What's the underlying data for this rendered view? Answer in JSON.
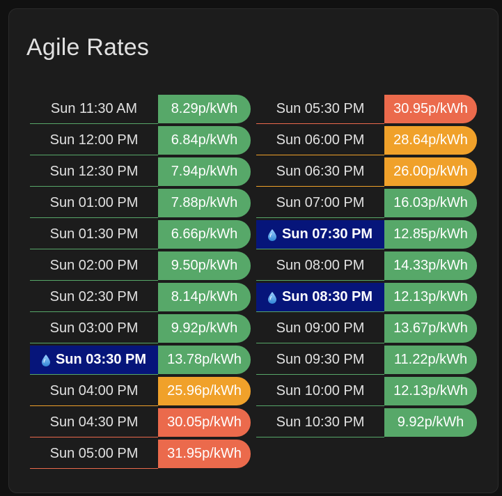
{
  "card": {
    "title": "Agile Rates"
  },
  "colors": {
    "green": "#57a869",
    "orange": "#f0a12a",
    "red": "#eb6a4c",
    "cheapest_bg": "#06157a"
  },
  "icons": {
    "cheapest": "water-drop-icon"
  },
  "columns": [
    [
      {
        "time": "Sun 11:30 AM",
        "price": "8.29p/kWh",
        "level": "green",
        "cheapest": false
      },
      {
        "time": "Sun 12:00 PM",
        "price": "6.84p/kWh",
        "level": "green",
        "cheapest": false
      },
      {
        "time": "Sun 12:30 PM",
        "price": "7.94p/kWh",
        "level": "green",
        "cheapest": false
      },
      {
        "time": "Sun 01:00 PM",
        "price": "7.88p/kWh",
        "level": "green",
        "cheapest": false
      },
      {
        "time": "Sun 01:30 PM",
        "price": "6.66p/kWh",
        "level": "green",
        "cheapest": false
      },
      {
        "time": "Sun 02:00 PM",
        "price": "9.50p/kWh",
        "level": "green",
        "cheapest": false
      },
      {
        "time": "Sun 02:30 PM",
        "price": "8.14p/kWh",
        "level": "green",
        "cheapest": false
      },
      {
        "time": "Sun 03:00 PM",
        "price": "9.92p/kWh",
        "level": "green",
        "cheapest": false
      },
      {
        "time": "Sun 03:30 PM",
        "price": "13.78p/kWh",
        "level": "green",
        "cheapest": true
      },
      {
        "time": "Sun 04:00 PM",
        "price": "25.96p/kWh",
        "level": "orange",
        "cheapest": false
      },
      {
        "time": "Sun 04:30 PM",
        "price": "30.05p/kWh",
        "level": "red",
        "cheapest": false
      },
      {
        "time": "Sun 05:00 PM",
        "price": "31.95p/kWh",
        "level": "red",
        "cheapest": false
      }
    ],
    [
      {
        "time": "Sun 05:30 PM",
        "price": "30.95p/kWh",
        "level": "red",
        "cheapest": false
      },
      {
        "time": "Sun 06:00 PM",
        "price": "28.64p/kWh",
        "level": "orange",
        "cheapest": false
      },
      {
        "time": "Sun 06:30 PM",
        "price": "26.00p/kWh",
        "level": "orange",
        "cheapest": false
      },
      {
        "time": "Sun 07:00 PM",
        "price": "16.03p/kWh",
        "level": "green",
        "cheapest": false
      },
      {
        "time": "Sun 07:30 PM",
        "price": "12.85p/kWh",
        "level": "green",
        "cheapest": true
      },
      {
        "time": "Sun 08:00 PM",
        "price": "14.33p/kWh",
        "level": "green",
        "cheapest": false
      },
      {
        "time": "Sun 08:30 PM",
        "price": "12.13p/kWh",
        "level": "green",
        "cheapest": true
      },
      {
        "time": "Sun 09:00 PM",
        "price": "13.67p/kWh",
        "level": "green",
        "cheapest": false
      },
      {
        "time": "Sun 09:30 PM",
        "price": "11.22p/kWh",
        "level": "green",
        "cheapest": false
      },
      {
        "time": "Sun 10:00 PM",
        "price": "12.13p/kWh",
        "level": "green",
        "cheapest": false
      },
      {
        "time": "Sun 10:30 PM",
        "price": "9.92p/kWh",
        "level": "green",
        "cheapest": false
      }
    ]
  ]
}
